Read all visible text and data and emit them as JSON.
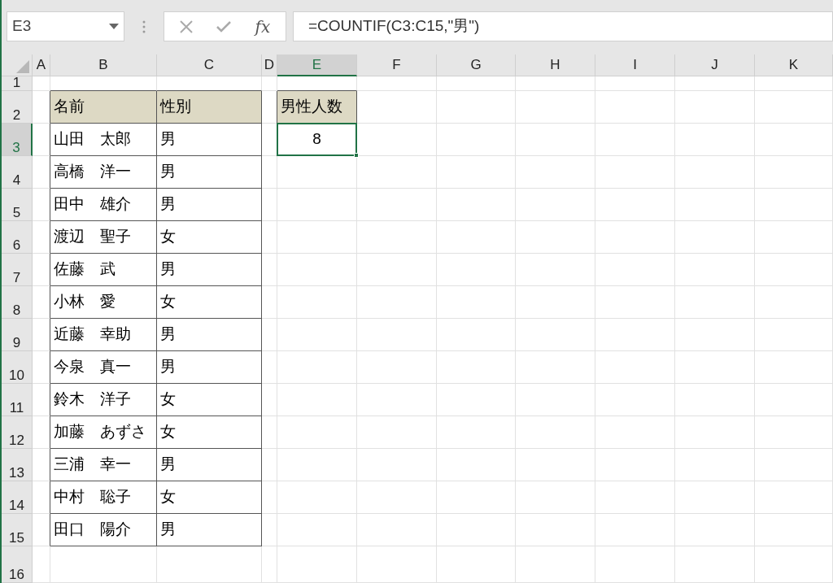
{
  "name_box": {
    "value": "E3"
  },
  "formula_bar": {
    "fx_label": "fx",
    "formula": "=COUNTIF(C3:C15,\"男\")"
  },
  "columns": [
    {
      "label": "A",
      "selected": false
    },
    {
      "label": "B",
      "selected": false
    },
    {
      "label": "C",
      "selected": false
    },
    {
      "label": "D",
      "selected": false
    },
    {
      "label": "E",
      "selected": true
    },
    {
      "label": "F",
      "selected": false
    },
    {
      "label": "G",
      "selected": false
    },
    {
      "label": "H",
      "selected": false
    },
    {
      "label": "I",
      "selected": false
    },
    {
      "label": "J",
      "selected": false
    },
    {
      "label": "K",
      "selected": false
    }
  ],
  "rows": [
    {
      "label": "1",
      "selected": false
    },
    {
      "label": "2",
      "selected": false
    },
    {
      "label": "3",
      "selected": true
    },
    {
      "label": "4",
      "selected": false
    },
    {
      "label": "5",
      "selected": false
    },
    {
      "label": "6",
      "selected": false
    },
    {
      "label": "7",
      "selected": false
    },
    {
      "label": "8",
      "selected": false
    },
    {
      "label": "9",
      "selected": false
    },
    {
      "label": "10",
      "selected": false
    },
    {
      "label": "11",
      "selected": false
    },
    {
      "label": "12",
      "selected": false
    },
    {
      "label": "13",
      "selected": false
    },
    {
      "label": "14",
      "selected": false
    },
    {
      "label": "15",
      "selected": false
    },
    {
      "label": "16",
      "selected": false
    }
  ],
  "name_table": {
    "columns": [
      "名前",
      "性別"
    ],
    "rows": [
      [
        "山田　太郎",
        "男"
      ],
      [
        "高橋　洋一",
        "男"
      ],
      [
        "田中　雄介",
        "男"
      ],
      [
        "渡辺　聖子",
        "女"
      ],
      [
        "佐藤　武",
        "男"
      ],
      [
        "小林　愛",
        "女"
      ],
      [
        "近藤　幸助",
        "男"
      ],
      [
        "今泉　真一",
        "男"
      ],
      [
        "鈴木　洋子",
        "女"
      ],
      [
        "加藤　あずさ",
        "女"
      ],
      [
        "三浦　幸一",
        "男"
      ],
      [
        "中村　聡子",
        "女"
      ],
      [
        "田口　陽介",
        "男"
      ]
    ]
  },
  "count_table": {
    "header": "男性人数",
    "value": "8",
    "selected": true
  }
}
